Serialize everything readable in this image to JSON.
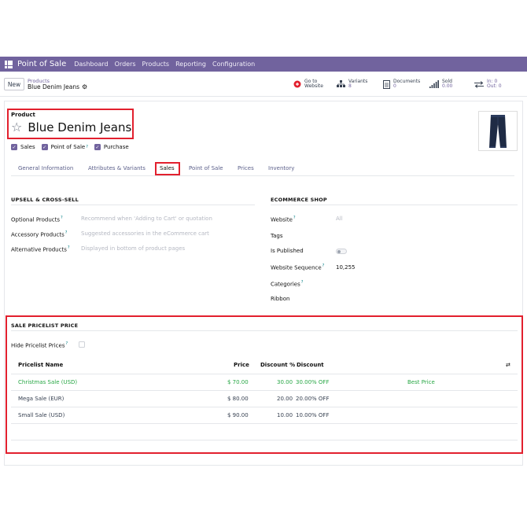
{
  "topbar": {
    "app_name": "Point of Sale",
    "menu": [
      "Dashboard",
      "Orders",
      "Products",
      "Reporting",
      "Configuration"
    ]
  },
  "control": {
    "new_label": "New",
    "breadcrumb_parent": "Products",
    "breadcrumb_current": "Blue Denim Jeans",
    "smart_buttons": [
      {
        "label": "Go to",
        "sub": "Website",
        "icon": "globe-icon"
      },
      {
        "label": "Variants",
        "sub": "8",
        "icon": "sitemap-icon"
      },
      {
        "label": "Documents",
        "sub": "0",
        "icon": "file-icon"
      },
      {
        "label": "Sold",
        "sub": "0.00",
        "icon": "bar-chart-icon"
      },
      {
        "label": "In: 0",
        "sub": "Out: 0",
        "icon": "exchange-icon"
      }
    ]
  },
  "product": {
    "label": "Product",
    "name": "Blue Denim Jeans",
    "checks": [
      "Sales",
      "Point of Sale",
      "Purchase"
    ]
  },
  "tabs": [
    "General Information",
    "Attributes & Variants",
    "Sales",
    "Point of Sale",
    "Prices",
    "Inventory"
  ],
  "upsell": {
    "title": "UPSELL & CROSS-SELL",
    "fields": [
      {
        "label": "Optional Products",
        "placeholder": "Recommend when 'Adding to Cart' or quotation"
      },
      {
        "label": "Accessory Products",
        "placeholder": "Suggested accessories in the eCommerce cart"
      },
      {
        "label": "Alternative Products",
        "placeholder": "Displayed in bottom of product pages"
      }
    ]
  },
  "ecommerce": {
    "title": "ECOMMERCE SHOP",
    "website_label": "Website",
    "website_placeholder": "All",
    "tags_label": "Tags",
    "published_label": "Is Published",
    "sequence_label": "Website Sequence",
    "sequence_value": "10,255",
    "categories_label": "Categories",
    "ribbon_label": "Ribbon"
  },
  "pricelist": {
    "title": "SALE PRICELIST PRICE",
    "hide_label": "Hide Pricelist Prices",
    "headers": [
      "Pricelist Name",
      "Price",
      "Discount %",
      "Discount"
    ],
    "rows": [
      {
        "name": "Christmas Sale (USD)",
        "price": "$ 70.00",
        "pct": "30.00",
        "discount": "30.00% OFF",
        "extra": "Best Price"
      },
      {
        "name": "Mega Sale (EUR)",
        "price": "$ 80.00",
        "pct": "20.00",
        "discount": "20.00% OFF",
        "extra": ""
      },
      {
        "name": "Small Sale (USD)",
        "price": "$ 90.00",
        "pct": "10.00",
        "discount": "10.00% OFF",
        "extra": ""
      }
    ]
  },
  "colors": {
    "brand": "#71639e",
    "highlight": "#e2202e",
    "best": "#28a745"
  }
}
